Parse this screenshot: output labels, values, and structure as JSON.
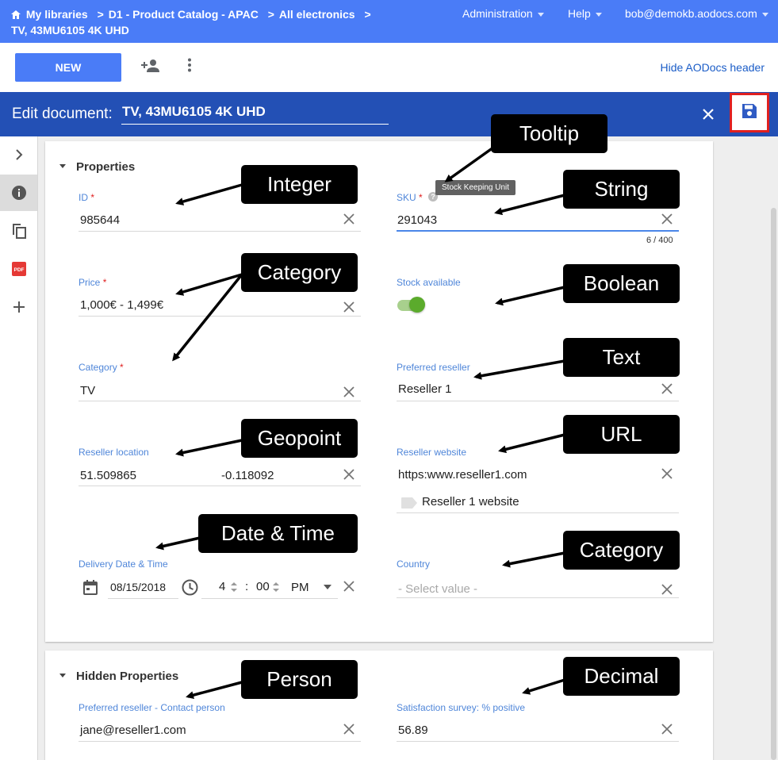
{
  "header": {
    "breadcrumb": [
      "My libraries",
      "D1 - Product Catalog - APAC",
      "All electronics",
      "TV, 43MU6105 4K UHD"
    ],
    "breadcrumb_separator": ">",
    "menu_administration": "Administration",
    "menu_help": "Help",
    "user_email": "bob@demokb.aodocs.com",
    "colors": {
      "header_bg": "#4a7cf7",
      "edit_bar_bg": "#2350b5"
    }
  },
  "toolbar": {
    "new_label": "NEW",
    "hide_header_label": "Hide AODocs header"
  },
  "edit_bar": {
    "label": "Edit document:",
    "title_value": "TV, 43MU6105 4K UHD"
  },
  "properties": {
    "title": "Properties",
    "id": {
      "label": "ID",
      "required": "*",
      "value": "985644"
    },
    "sku": {
      "label": "SKU",
      "required": "*",
      "value": "291043",
      "tooltip": "Stock Keeping Unit",
      "counter": "6 / 400"
    },
    "price": {
      "label": "Price",
      "required": "*",
      "value": "1,000€ - 1,499€"
    },
    "stock": {
      "label": "Stock available",
      "on": true
    },
    "category": {
      "label": "Category",
      "required": "*",
      "value": "TV"
    },
    "preferred_reseller": {
      "label": "Preferred reseller",
      "value": "Reseller 1"
    },
    "reseller_location": {
      "label": "Reseller location",
      "lat": "51.509865",
      "lng": "-0.118092"
    },
    "reseller_website": {
      "label": "Reseller website",
      "url": "https:www.reseller1.com",
      "link_label": "Reseller 1 website"
    },
    "delivery": {
      "label": "Delivery Date & Time",
      "date": "08/15/2018",
      "hour": "4",
      "colon": ":",
      "minute": "00",
      "ampm": "PM"
    },
    "country": {
      "label": "Country",
      "placeholder": "- Select value -"
    }
  },
  "hidden_properties": {
    "title": "Hidden Properties",
    "contact": {
      "label": "Preferred reseller - Contact person",
      "value": "jane@reseller1.com"
    },
    "satisfaction": {
      "label": "Satisfaction survey: % positive",
      "value": "56.89"
    }
  },
  "annotations": {
    "integer": "Integer",
    "tooltip": "Tooltip",
    "string": "String",
    "category_left": "Category",
    "boolean": "Boolean",
    "text": "Text",
    "geopoint": "Geopoint",
    "url": "URL",
    "date_time": "Date & Time",
    "category_right": "Category",
    "person": "Person",
    "decimal": "Decimal"
  }
}
